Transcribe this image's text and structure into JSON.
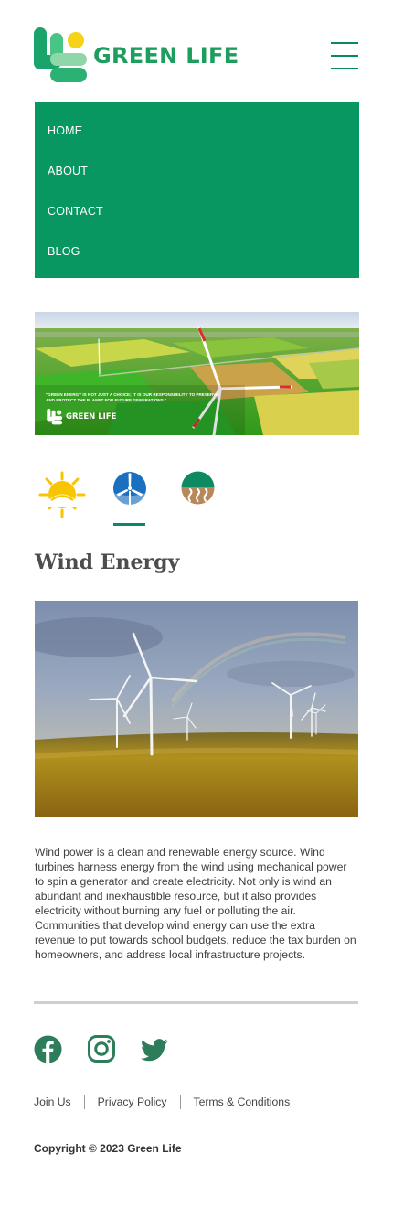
{
  "brand": {
    "name": "GREEN LIFE"
  },
  "nav": {
    "items": [
      {
        "label": "HOME"
      },
      {
        "label": "ABOUT"
      },
      {
        "label": "CONTACT"
      },
      {
        "label": "BLOG"
      }
    ]
  },
  "banner": {
    "quote": "\"Green energy is not just a choice; it is our responsibility to preserve and protect the planet for future generations.\"",
    "logo_text": "GREEN LIFE"
  },
  "energy_tabs": [
    {
      "icon": "sun-icon",
      "active": false
    },
    {
      "icon": "wind-turbine-icon",
      "active": true
    },
    {
      "icon": "geothermal-icon",
      "active": false
    }
  ],
  "section": {
    "title": "Wind Energy",
    "description": "Wind power is a clean and renewable energy source. Wind turbines harness energy from the wind using mechanical power to spin a generator and create electricity. Not only is wind an abundant and inexhaustible resource, but it also provides electricity without burning any fuel or polluting the air. Communities that develop wind energy can use the extra revenue to put towards school budgets, reduce the tax burden on homeowners, and address local infrastructure projects."
  },
  "social": [
    "facebook-icon",
    "instagram-icon",
    "twitter-icon"
  ],
  "footer": {
    "links": [
      {
        "label": "Join Us"
      },
      {
        "label": "Privacy Policy"
      },
      {
        "label": "Terms & Conditions"
      }
    ],
    "copyright": "Copyright © 2023 Green Life"
  },
  "colors": {
    "brand_green": "#089760",
    "logo_green": "#1e9e5e",
    "sun_yellow": "#f7c600",
    "turbine_blue": "#1a6fbf"
  }
}
